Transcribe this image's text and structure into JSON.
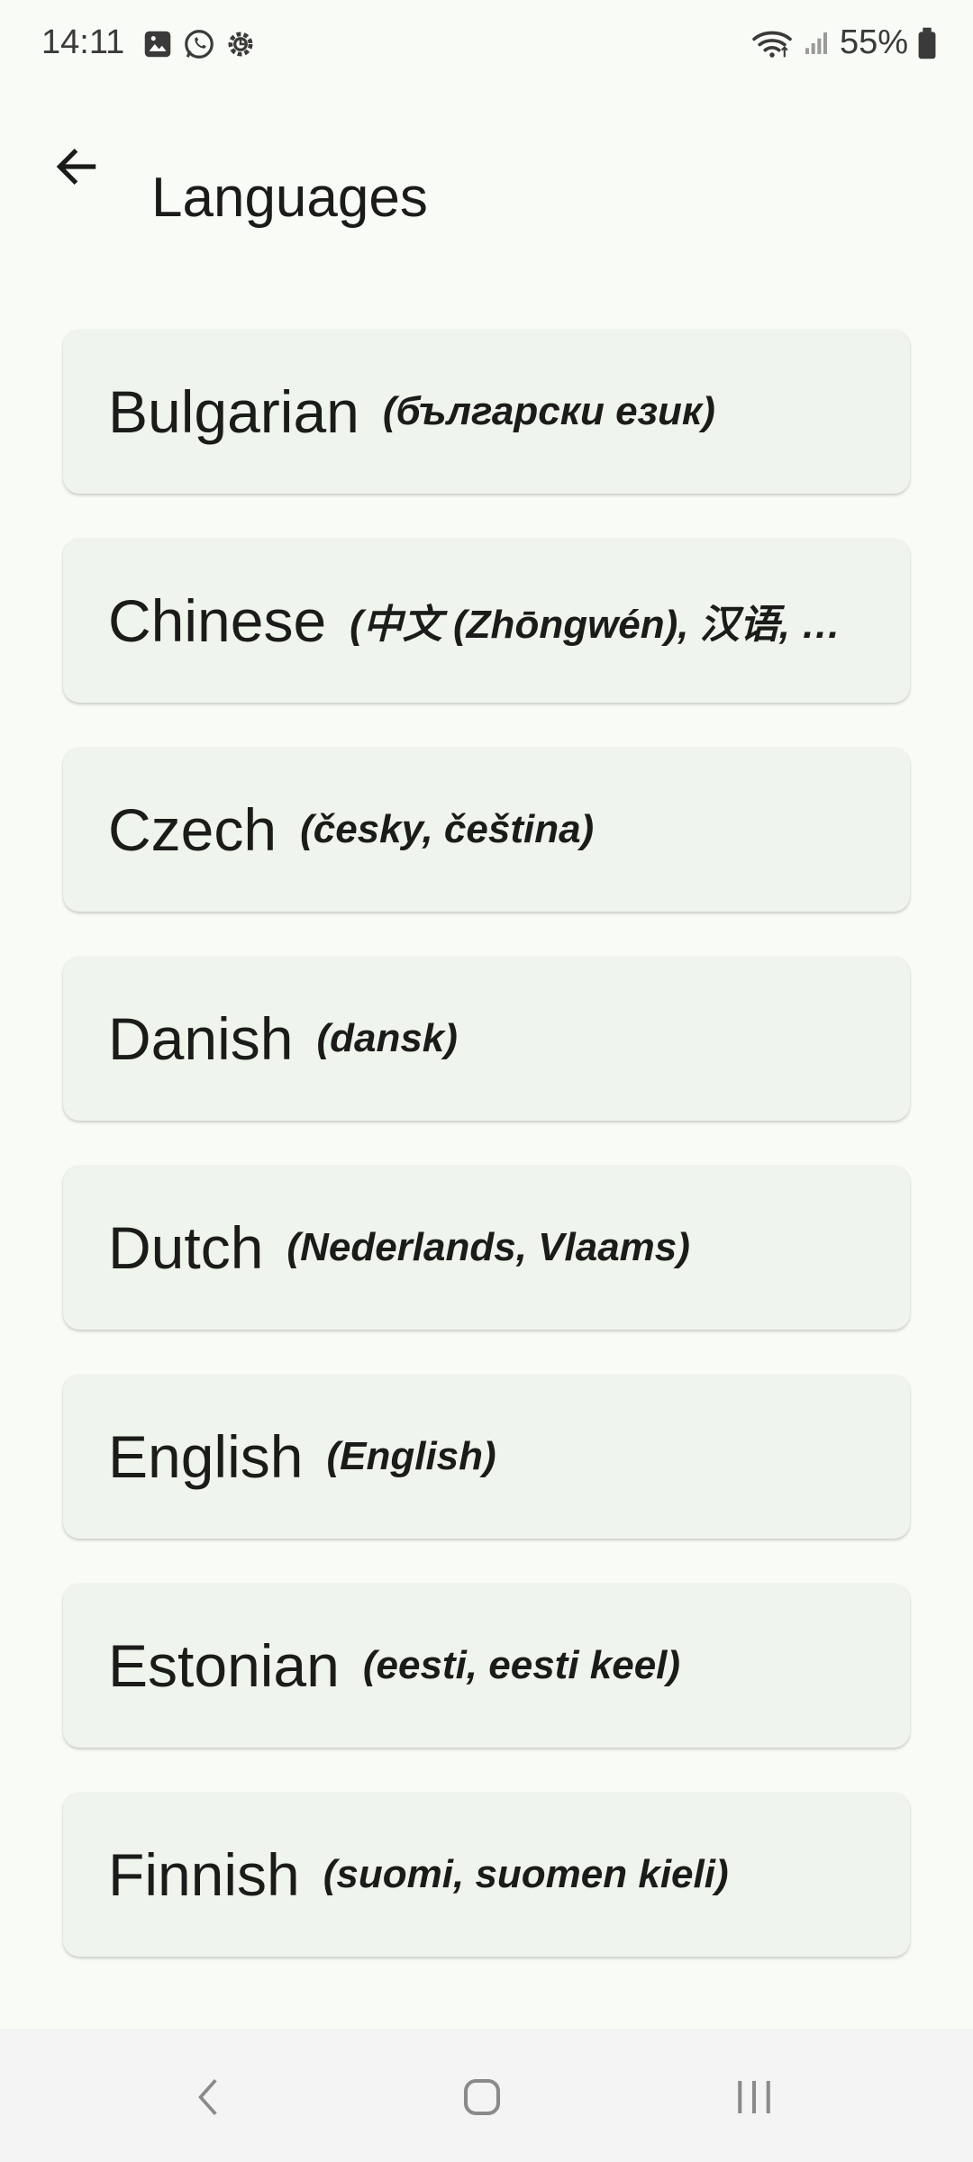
{
  "status_bar": {
    "time": "14:11",
    "battery": "55%",
    "icons_left": [
      "gallery-icon",
      "whatsapp-icon",
      "settings-notification-icon"
    ],
    "icons_right": [
      "wifi-icon",
      "signal-icon",
      "battery-icon"
    ]
  },
  "app_bar": {
    "title": "Languages",
    "back_icon": "arrow-back-icon"
  },
  "languages": [
    {
      "name": "Bulgarian",
      "native": "(български език)"
    },
    {
      "name": "Chinese",
      "native": "(中文 (Zhōngwén), 汉语, 漢語)"
    },
    {
      "name": "Czech",
      "native": "(česky, čeština)"
    },
    {
      "name": "Danish",
      "native": "(dansk)"
    },
    {
      "name": "Dutch",
      "native": "(Nederlands, Vlaams)"
    },
    {
      "name": "English",
      "native": "(English)"
    },
    {
      "name": "Estonian",
      "native": "(eesti, eesti keel)"
    },
    {
      "name": "Finnish",
      "native": "(suomi, suomen kieli)"
    }
  ],
  "nav_bar": {
    "back": "nav-back-icon",
    "home": "nav-home-icon",
    "recents": "nav-recents-icon"
  },
  "colors": {
    "background": "#f8fbf6",
    "card": "#eff4ed",
    "nav_bar": "#f4f4f4",
    "text": "#1b1c1a"
  }
}
